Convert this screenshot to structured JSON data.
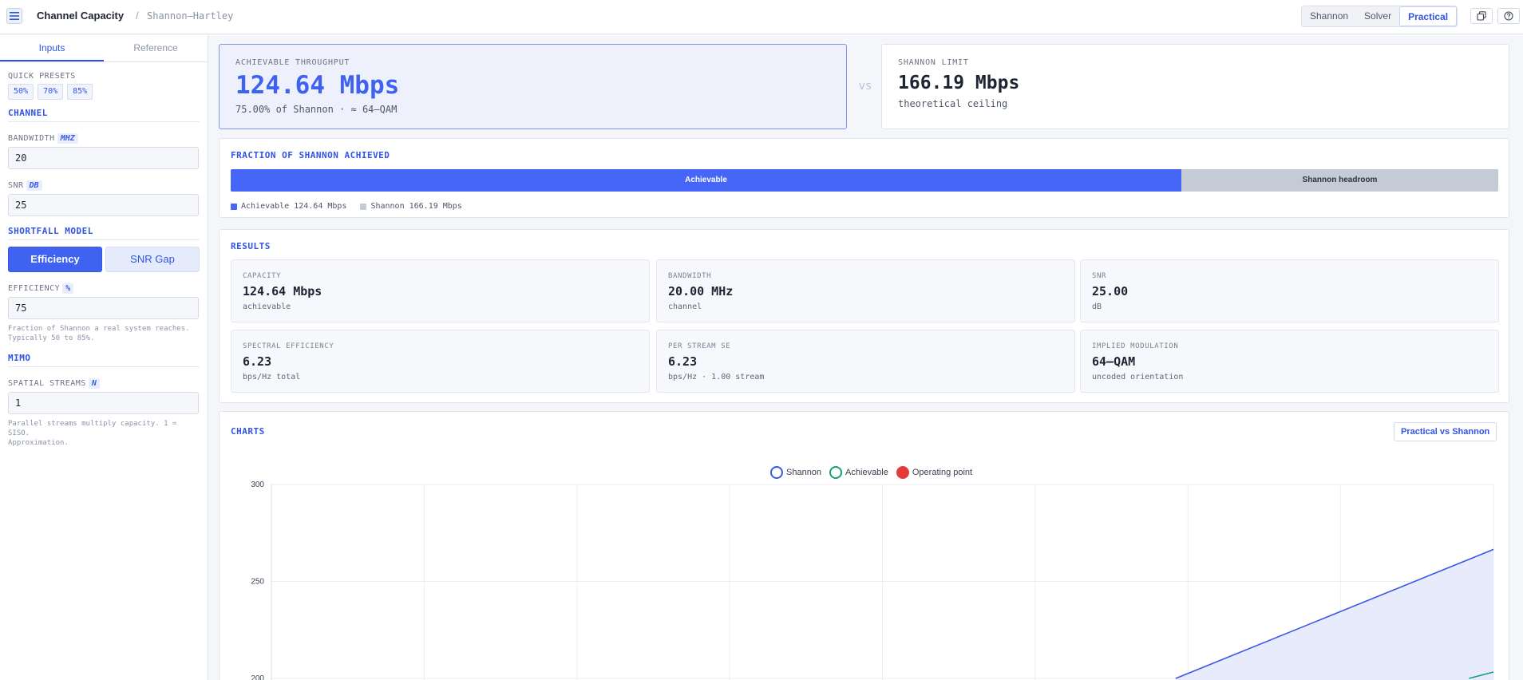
{
  "header": {
    "title": "Channel Capacity",
    "separator": "/",
    "subtitle": "Shannon–Hartley",
    "modes": [
      "Shannon",
      "Solver",
      "Practical"
    ],
    "active_mode": "Practical",
    "icons": [
      "menu-icon",
      "copy-icon",
      "help-icon"
    ]
  },
  "sidebar": {
    "tabs": [
      "Inputs",
      "Reference"
    ],
    "quick_presets": {
      "label": "QUICK PRESETS",
      "items": [
        "50%",
        "70%",
        "85%"
      ]
    },
    "channel": {
      "section": "CHANNEL",
      "bandwidth_label": "BANDWIDTH",
      "bandwidth_unit": "MHZ",
      "bandwidth_value": "20",
      "snr_label": "SNR",
      "snr_unit": "DB",
      "snr_value": "25"
    },
    "shortfall": {
      "section": "SHORTFALL MODEL",
      "options": [
        "Efficiency",
        "SNR Gap"
      ],
      "efficiency_label": "EFFICIENCY",
      "efficiency_unit": "%",
      "efficiency_value": "75",
      "hint_line1": "Fraction of Shannon a real system reaches.",
      "hint_line2": "Typically 50 to 85%."
    },
    "mimo": {
      "section": "MIMO",
      "streams_label": "SPATIAL STREAMS",
      "streams_unit": "N",
      "streams_value": "1",
      "hint_line1": "Parallel streams multiply capacity. 1 = SISO.",
      "hint_line2": "Approximation."
    }
  },
  "hero": {
    "achievable_label": "ACHIEVABLE THROUGHPUT",
    "achievable_value": "124.64 Mbps",
    "achievable_sub": "75.00% of Shannon · ≈ 64–QAM",
    "vs": "vs",
    "limit_label": "SHANNON LIMIT",
    "limit_value": "166.19 Mbps",
    "limit_sub": "theoretical ceiling"
  },
  "fraction": {
    "title": "FRACTION OF SHANNON ACHIEVED",
    "achievable_fraction": 0.75,
    "bar_left": "Achievable",
    "bar_right": "Shannon headroom",
    "legend_achievable": "Achievable 124.64 Mbps",
    "legend_shannon": "Shannon 166.19 Mbps"
  },
  "results": {
    "title": "RESULTS",
    "items": [
      {
        "k": "CAPACITY",
        "v": "124.64 Mbps",
        "s": "achievable"
      },
      {
        "k": "BANDWIDTH",
        "v": "20.00 MHz",
        "s": "channel"
      },
      {
        "k": "SNR",
        "v": "25.00",
        "s": "dB"
      },
      {
        "k": "SPECTRAL EFFICIENCY",
        "v": "6.23",
        "s": "bps/Hz total"
      },
      {
        "k": "PER STREAM SE",
        "v": "6.23",
        "s": "bps/Hz · 1.00 stream"
      },
      {
        "k": "IMPLIED MODULATION",
        "v": "64–QAM",
        "s": "uncoded orientation"
      }
    ]
  },
  "charts": {
    "title": "CHARTS",
    "view_button": "Practical vs Shannon"
  },
  "chart_data": {
    "type": "line",
    "title": "",
    "xlabel": "",
    "ylabel": "",
    "ylim": [
      200,
      300
    ],
    "yticks": [
      300,
      250,
      200
    ],
    "grid": true,
    "legend_placement": "top-center",
    "series": [
      {
        "name": "Shannon",
        "color": "#3b57e8",
        "fill": true,
        "x_frac": [
          0.74,
          1.0
        ],
        "y": [
          200,
          266.5
        ]
      },
      {
        "name": "Achievable",
        "color": "#12a079",
        "fill": false,
        "x_frac": [
          0.98,
          1.0
        ],
        "y": [
          200,
          203.3
        ]
      },
      {
        "name": "Operating point",
        "color": "#e53a3a",
        "points": []
      }
    ]
  },
  "colors": {
    "accent": "#2f54e6",
    "achievable": "#4566f6",
    "headroom": "#c4cad6",
    "operating": "#e53a3a",
    "achievable_line": "#12a079"
  }
}
